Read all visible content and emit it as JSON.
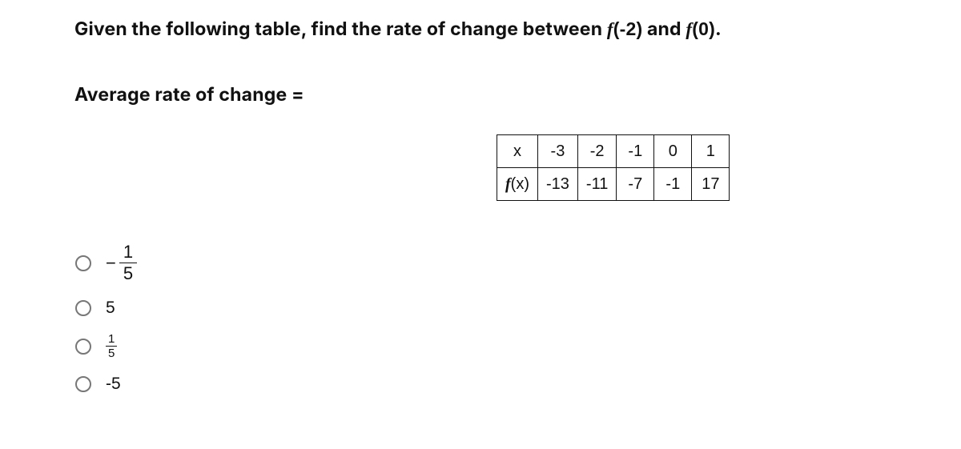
{
  "question": {
    "prefix": "Given the following table, find the rate of change between ",
    "f1_sym": "f",
    "f1_arg": "(-2)",
    "between": " and ",
    "f2_sym": "f",
    "f2_arg": "(0)",
    "suffix": "."
  },
  "prompt": "Average rate of change =",
  "table": {
    "row_labels": {
      "x": "x",
      "fx_sym": "f",
      "fx_arg": "(x)"
    },
    "x": [
      "-3",
      "-2",
      "-1",
      "0",
      "1"
    ],
    "fx": [
      "-13",
      "-11",
      "-7",
      "-1",
      "17"
    ]
  },
  "options": {
    "a": {
      "neg": "−",
      "num": "1",
      "den": "5"
    },
    "b": {
      "text": "5"
    },
    "c": {
      "num": "1",
      "den": "5"
    },
    "d": {
      "text": "-5"
    }
  }
}
